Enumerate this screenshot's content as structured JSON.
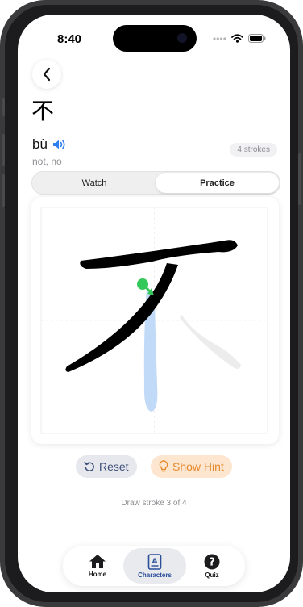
{
  "status_bar": {
    "time": "8:40"
  },
  "character": {
    "hanzi": "不",
    "pinyin": "bù",
    "meaning": "not, no",
    "strokes_badge": "4 strokes"
  },
  "mode_tabs": [
    {
      "label": "Watch",
      "selected": false
    },
    {
      "label": "Practice",
      "selected": true
    }
  ],
  "actions": {
    "reset_label": "Reset",
    "hint_label": "Show Hint"
  },
  "instruction": "Draw stroke 3 of 4",
  "tab_bar": [
    {
      "label": "Home",
      "icon": "house-icon",
      "selected": false
    },
    {
      "label": "Characters",
      "icon": "book-icon",
      "selected": true
    },
    {
      "label": "Quiz",
      "icon": "question-circle-icon",
      "selected": false
    }
  ],
  "colors": {
    "accent": "#2f7ff0",
    "hint_orange": "#e58a2e",
    "stroke_guide": "#b9d6f6",
    "start_dot": "#34c759"
  }
}
